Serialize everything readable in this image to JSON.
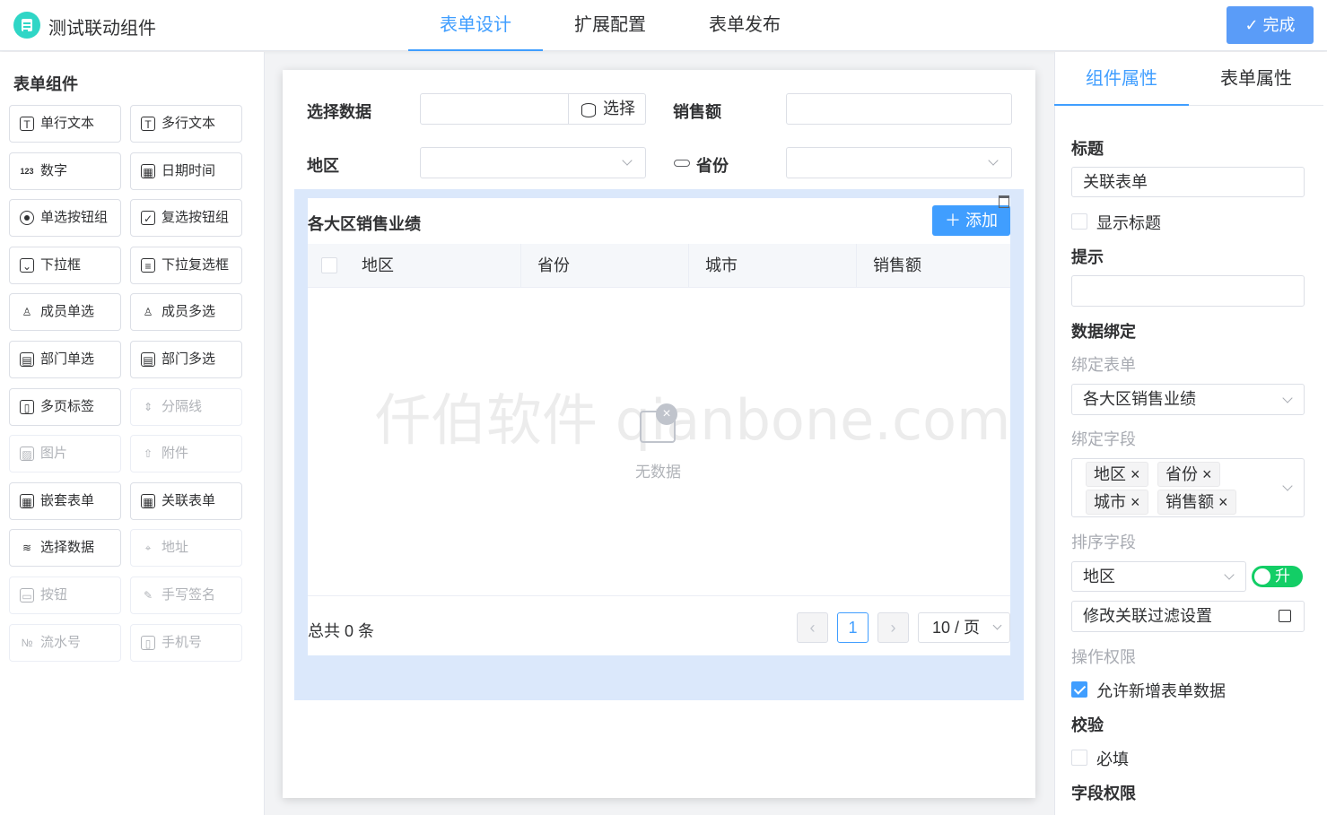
{
  "app": {
    "title": "测试联动组件"
  },
  "tabs": [
    {
      "label": "表单设计",
      "active": true
    },
    {
      "label": "扩展配置",
      "active": false
    },
    {
      "label": "表单发布",
      "active": false
    }
  ],
  "done_label": "✓ 完成",
  "left": {
    "title": "表单组件",
    "components": [
      {
        "label": "单行文本",
        "icon": "text-icon",
        "enabled": true
      },
      {
        "label": "多行文本",
        "icon": "multiline-icon",
        "enabled": true
      },
      {
        "label": "数字",
        "icon": "number-icon",
        "enabled": true
      },
      {
        "label": "日期时间",
        "icon": "calendar-icon",
        "enabled": true
      },
      {
        "label": "单选按钮组",
        "icon": "radio-icon",
        "enabled": true
      },
      {
        "label": "复选按钮组",
        "icon": "checkbox-icon",
        "enabled": true
      },
      {
        "label": "下拉框",
        "icon": "dropdown-icon",
        "enabled": true
      },
      {
        "label": "下拉复选框",
        "icon": "multi-dropdown-icon",
        "enabled": true
      },
      {
        "label": "成员单选",
        "icon": "user-icon",
        "enabled": true
      },
      {
        "label": "成员多选",
        "icon": "users-icon",
        "enabled": true
      },
      {
        "label": "部门单选",
        "icon": "department-icon",
        "enabled": true
      },
      {
        "label": "部门多选",
        "icon": "departments-icon",
        "enabled": true
      },
      {
        "label": "多页标签",
        "icon": "tabs-icon",
        "enabled": true
      },
      {
        "label": "分隔线",
        "icon": "divider-icon",
        "enabled": false
      },
      {
        "label": "图片",
        "icon": "image-icon",
        "enabled": false
      },
      {
        "label": "附件",
        "icon": "upload-icon",
        "enabled": false
      },
      {
        "label": "嵌套表单",
        "icon": "subform-icon",
        "enabled": true
      },
      {
        "label": "关联表单",
        "icon": "linked-form-icon",
        "enabled": true
      },
      {
        "label": "选择数据",
        "icon": "database-icon",
        "enabled": true
      },
      {
        "label": "地址",
        "icon": "location-icon",
        "enabled": false
      },
      {
        "label": "按钮",
        "icon": "button-icon",
        "enabled": false
      },
      {
        "label": "手写签名",
        "icon": "signature-icon",
        "enabled": false
      },
      {
        "label": "流水号",
        "icon": "serial-number-icon",
        "enabled": false
      },
      {
        "label": "手机号",
        "icon": "phone-icon",
        "enabled": false
      }
    ]
  },
  "form": {
    "select_data_label": "选择数据",
    "select_button": "选择",
    "sales_label": "销售额",
    "region_label": "地区",
    "province_label": "省份",
    "subform": {
      "title": "各大区销售业绩",
      "add_button": "＋ 添加",
      "columns": [
        "地区",
        "省份",
        "城市",
        "销售额"
      ],
      "empty_text": "无数据",
      "total_text": "总共 0 条",
      "current_page": "1",
      "page_size": "10 / 页"
    },
    "watermark": "仟伯软件 qianbone.com"
  },
  "right": {
    "tabs": [
      "组件属性",
      "表单属性"
    ],
    "title_label": "标题",
    "title_value": "关联表单",
    "show_title_label": "显示标题",
    "hint_label": "提示",
    "binding_label": "数据绑定",
    "bind_form_label": "绑定表单",
    "bind_form_value": "各大区销售业绩",
    "bind_fields_label": "绑定字段",
    "bind_fields": [
      "地区",
      "省份",
      "城市",
      "销售额"
    ],
    "sort_label": "排序字段",
    "sort_value": "地区",
    "sort_order": "升",
    "filter_button": "修改关联过滤设置",
    "permission_label": "操作权限",
    "allow_add_label": "允许新增表单数据",
    "validation_label": "校验",
    "required_label": "必填",
    "field_permission_label": "字段权限"
  },
  "colors": {
    "accent": "#409eff",
    "switch_on": "#13ce66",
    "logo": "#2fd6c6"
  }
}
